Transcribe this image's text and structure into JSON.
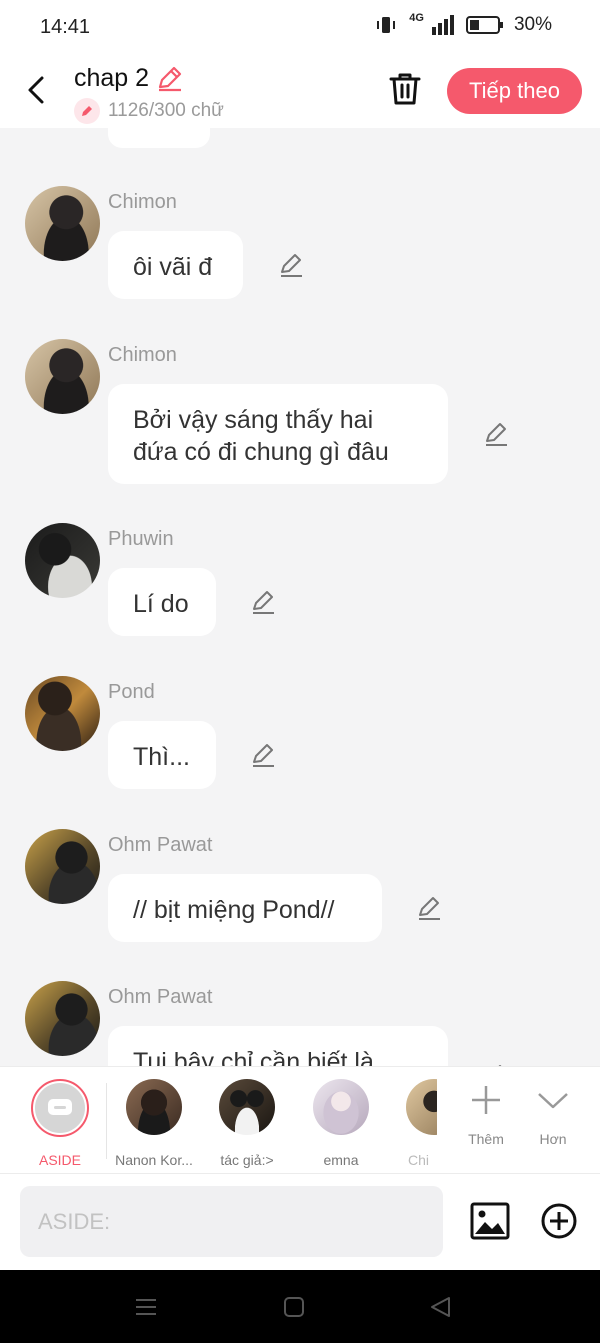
{
  "status_bar": {
    "time": "14:41",
    "network": "4G",
    "battery": "30%"
  },
  "header": {
    "title": "chap 2",
    "word_count": "1126/300 chữ",
    "next_label": "Tiếp theo"
  },
  "colors": {
    "accent": "#f5596c",
    "background": "#f4f4f5",
    "bubble": "#ffffff",
    "name": "#999999"
  },
  "messages": [
    {
      "sender": "Chimon",
      "text": "ôi vãi đ"
    },
    {
      "sender": "Chimon",
      "text": "Bởi vậy sáng thấy hai đứa có đi chung gì đâu"
    },
    {
      "sender": "Phuwin",
      "text": "Lí do"
    },
    {
      "sender": "Pond",
      "text": "Thì..."
    },
    {
      "sender": "Ohm Pawat",
      "text": "// bịt miệng Pond//"
    },
    {
      "sender": "Ohm Pawat",
      "text": "Tui bây chỉ cần biết là"
    }
  ],
  "characters": [
    {
      "label": "ASIDE",
      "selected": true
    },
    {
      "label": "Nanon Kor..."
    },
    {
      "label": "tác giả:>"
    },
    {
      "label": "emna"
    },
    {
      "label": "Chi"
    }
  ],
  "tools": {
    "add_label": "Thêm",
    "more_label": "Hơn"
  },
  "composer": {
    "placeholder": "ASIDE:"
  }
}
